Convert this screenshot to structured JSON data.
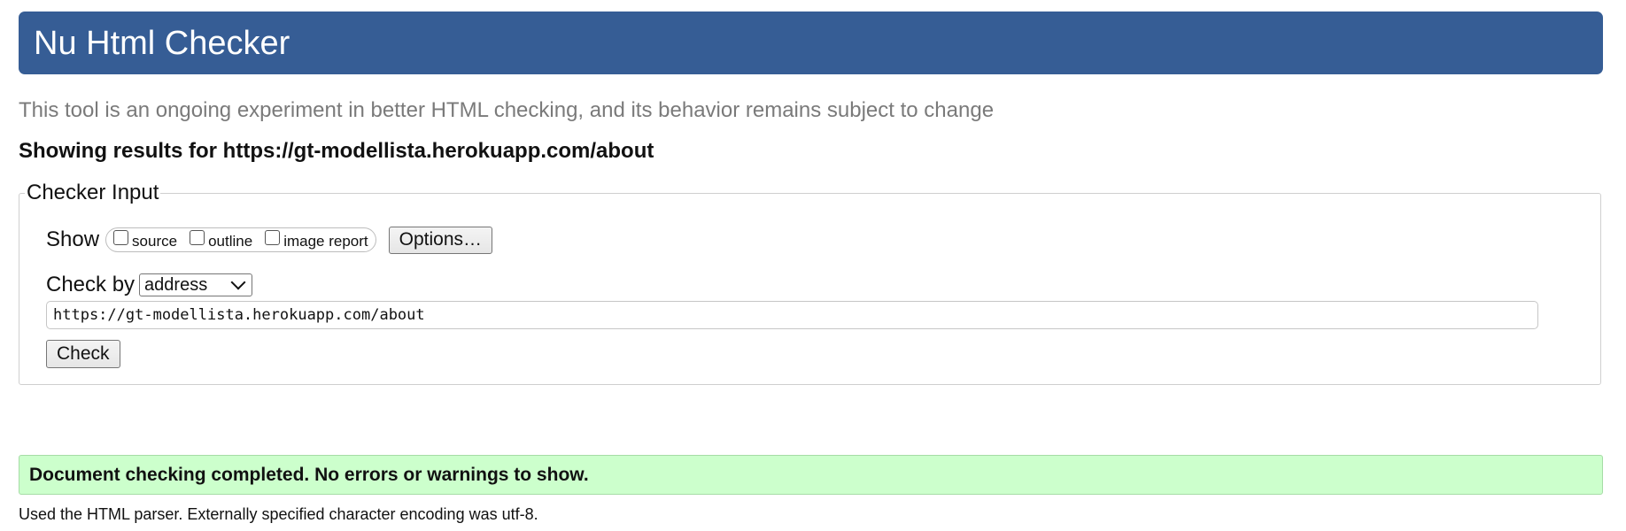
{
  "header": {
    "title": "Nu Html Checker"
  },
  "subtitle": "This tool is an ongoing experiment in better HTML checking, and its behavior remains subject to change",
  "results_for": "Showing results for https://gt-modellista.herokuapp.com/about",
  "checker_input": {
    "legend": "Checker Input",
    "show_label": "Show",
    "show_options": [
      {
        "label": "source",
        "checked": false
      },
      {
        "label": "outline",
        "checked": false
      },
      {
        "label": "image report",
        "checked": false
      }
    ],
    "options_button": "Options…",
    "check_by_label": "Check by",
    "check_by_selected": "address",
    "url_value": "https://gt-modellista.herokuapp.com/about",
    "check_button": "Check"
  },
  "result": {
    "success_message": "Document checking completed. No errors or warnings to show.",
    "parser_note": "Used the HTML parser. Externally specified character encoding was utf-8."
  },
  "colors": {
    "header_bg": "#365d95",
    "success_bg": "#ccffcc",
    "subtitle_text": "#7a7a7a"
  }
}
